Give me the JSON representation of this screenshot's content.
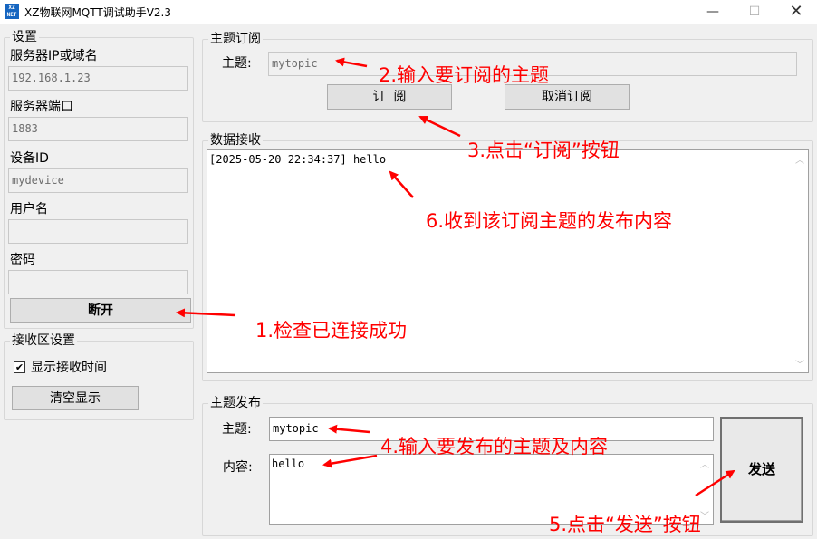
{
  "window": {
    "title": "XZ物联网MQTT调试助手V2.3",
    "icon_text": "XZ NET",
    "minimize_glyph": "—",
    "maximize_glyph": "☐",
    "close_glyph": "✕"
  },
  "settings": {
    "title": "设置",
    "server_label": "服务器IP或域名",
    "server_value": "192.168.1.23",
    "port_label": "服务器端口",
    "port_value": "1883",
    "device_label": "设备ID",
    "device_value": "mydevice",
    "user_label": "用户名",
    "user_value": "",
    "password_label": "密码",
    "password_value": "",
    "connect_button": "断开"
  },
  "receive_settings": {
    "title": "接收区设置",
    "show_time_label": "显示接收时间",
    "show_time_checked": true,
    "check_glyph": "✔",
    "clear_button": "清空显示"
  },
  "subscribe": {
    "title": "主题订阅",
    "topic_label": "主题:",
    "topic_value": "mytopic",
    "subscribe_button": "订  阅",
    "unsubscribe_button": "取消订阅"
  },
  "data_receive": {
    "title": "数据接收",
    "lines": [
      "[2025-05-20 22:34:37] hello"
    ],
    "scroll_up": "︿",
    "scroll_down": "﹀"
  },
  "publish": {
    "title": "主题发布",
    "topic_label": "主题:",
    "topic_value": "mytopic",
    "content_label": "内容:",
    "content_value": "hello",
    "send_button": "发送"
  },
  "annotations": {
    "a1": "1.检查已连接成功",
    "a2": "2.输入要订阅的主题",
    "a3": "3.点击“订阅”按钮",
    "a4": "4.输入要发布的主题及内容",
    "a5": "5.点击“发送”按钮",
    "a6": "6.收到该订阅主题的发布内容"
  },
  "colors": {
    "annotation": "#ff0000",
    "window_bg": "#f0f0f0",
    "icon_bg": "#1565c0"
  }
}
